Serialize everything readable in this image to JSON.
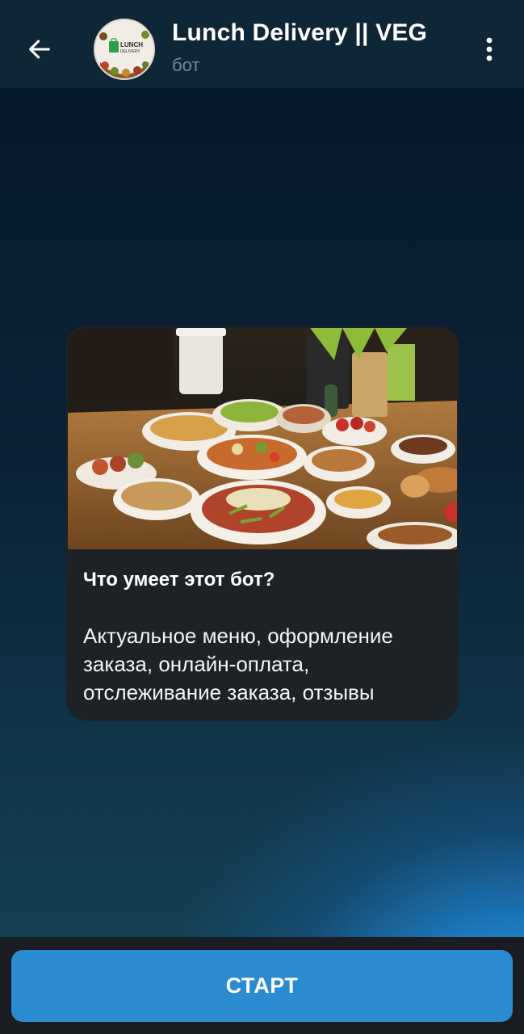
{
  "header": {
    "title": "Lunch Delivery || VEG",
    "subtitle": "бот",
    "back_icon": "arrow-left-icon",
    "menu_icon": "more-vertical-icon",
    "avatar_logo_text": "LUNCH DELIVERY"
  },
  "card": {
    "heading": "Что умеет этот бот?",
    "body": "Актуальное меню, оформление заказа, онлайн-оплата, отслеживание заказа, отзывы"
  },
  "bottom": {
    "start_label": "СТАРТ"
  },
  "colors": {
    "header_bg": "#0f2637",
    "card_bg": "#1d2227",
    "button_bg": "#2a8bd0",
    "subtitle": "#6f8a9e"
  }
}
